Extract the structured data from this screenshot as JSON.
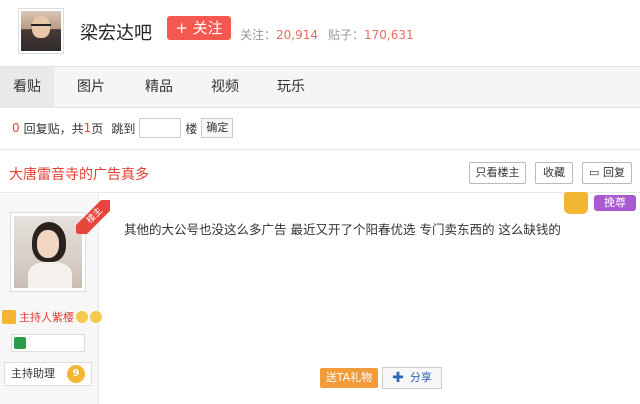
{
  "header": {
    "bar_name": "梁宏达吧",
    "follow_label": "+ 关注",
    "follow_count_label": "关注：",
    "follow_count": "20,914",
    "posts_count_label": "贴子：",
    "posts_count": "170,631"
  },
  "nav": {
    "tabs": [
      {
        "label": "看贴"
      },
      {
        "label": "图片"
      },
      {
        "label": "精品"
      },
      {
        "label": "视频"
      },
      {
        "label": "玩乐"
      }
    ]
  },
  "pager": {
    "reply_count": "0",
    "reply_text": "回复贴，共",
    "page_count": "1",
    "page_unit": "页",
    "jump_label": "跳到",
    "floor_label": "楼",
    "confirm_label": "确定"
  },
  "thread": {
    "title": "大唐雷音寺的广告真多",
    "only_owner_label": "只看楼主",
    "favorite_label": "收藏",
    "reply_label": "回复"
  },
  "post": {
    "ribbon_label": "楼主",
    "author_role": "主持人紫樱",
    "level_title": "主持助理",
    "level": "9",
    "vip_label": "挽尊",
    "content": "其他的大公号也没这么多广告 最近又开了个阳春优选 专门卖东西的 这么缺钱的",
    "gift_label": "送TA礼物",
    "share_label": "分享"
  },
  "colors": {
    "accent_red": "#e8453c",
    "follow_button": "#f4584e",
    "gift_button": "#f29b3b",
    "vip_purple": "#a95ad1"
  }
}
